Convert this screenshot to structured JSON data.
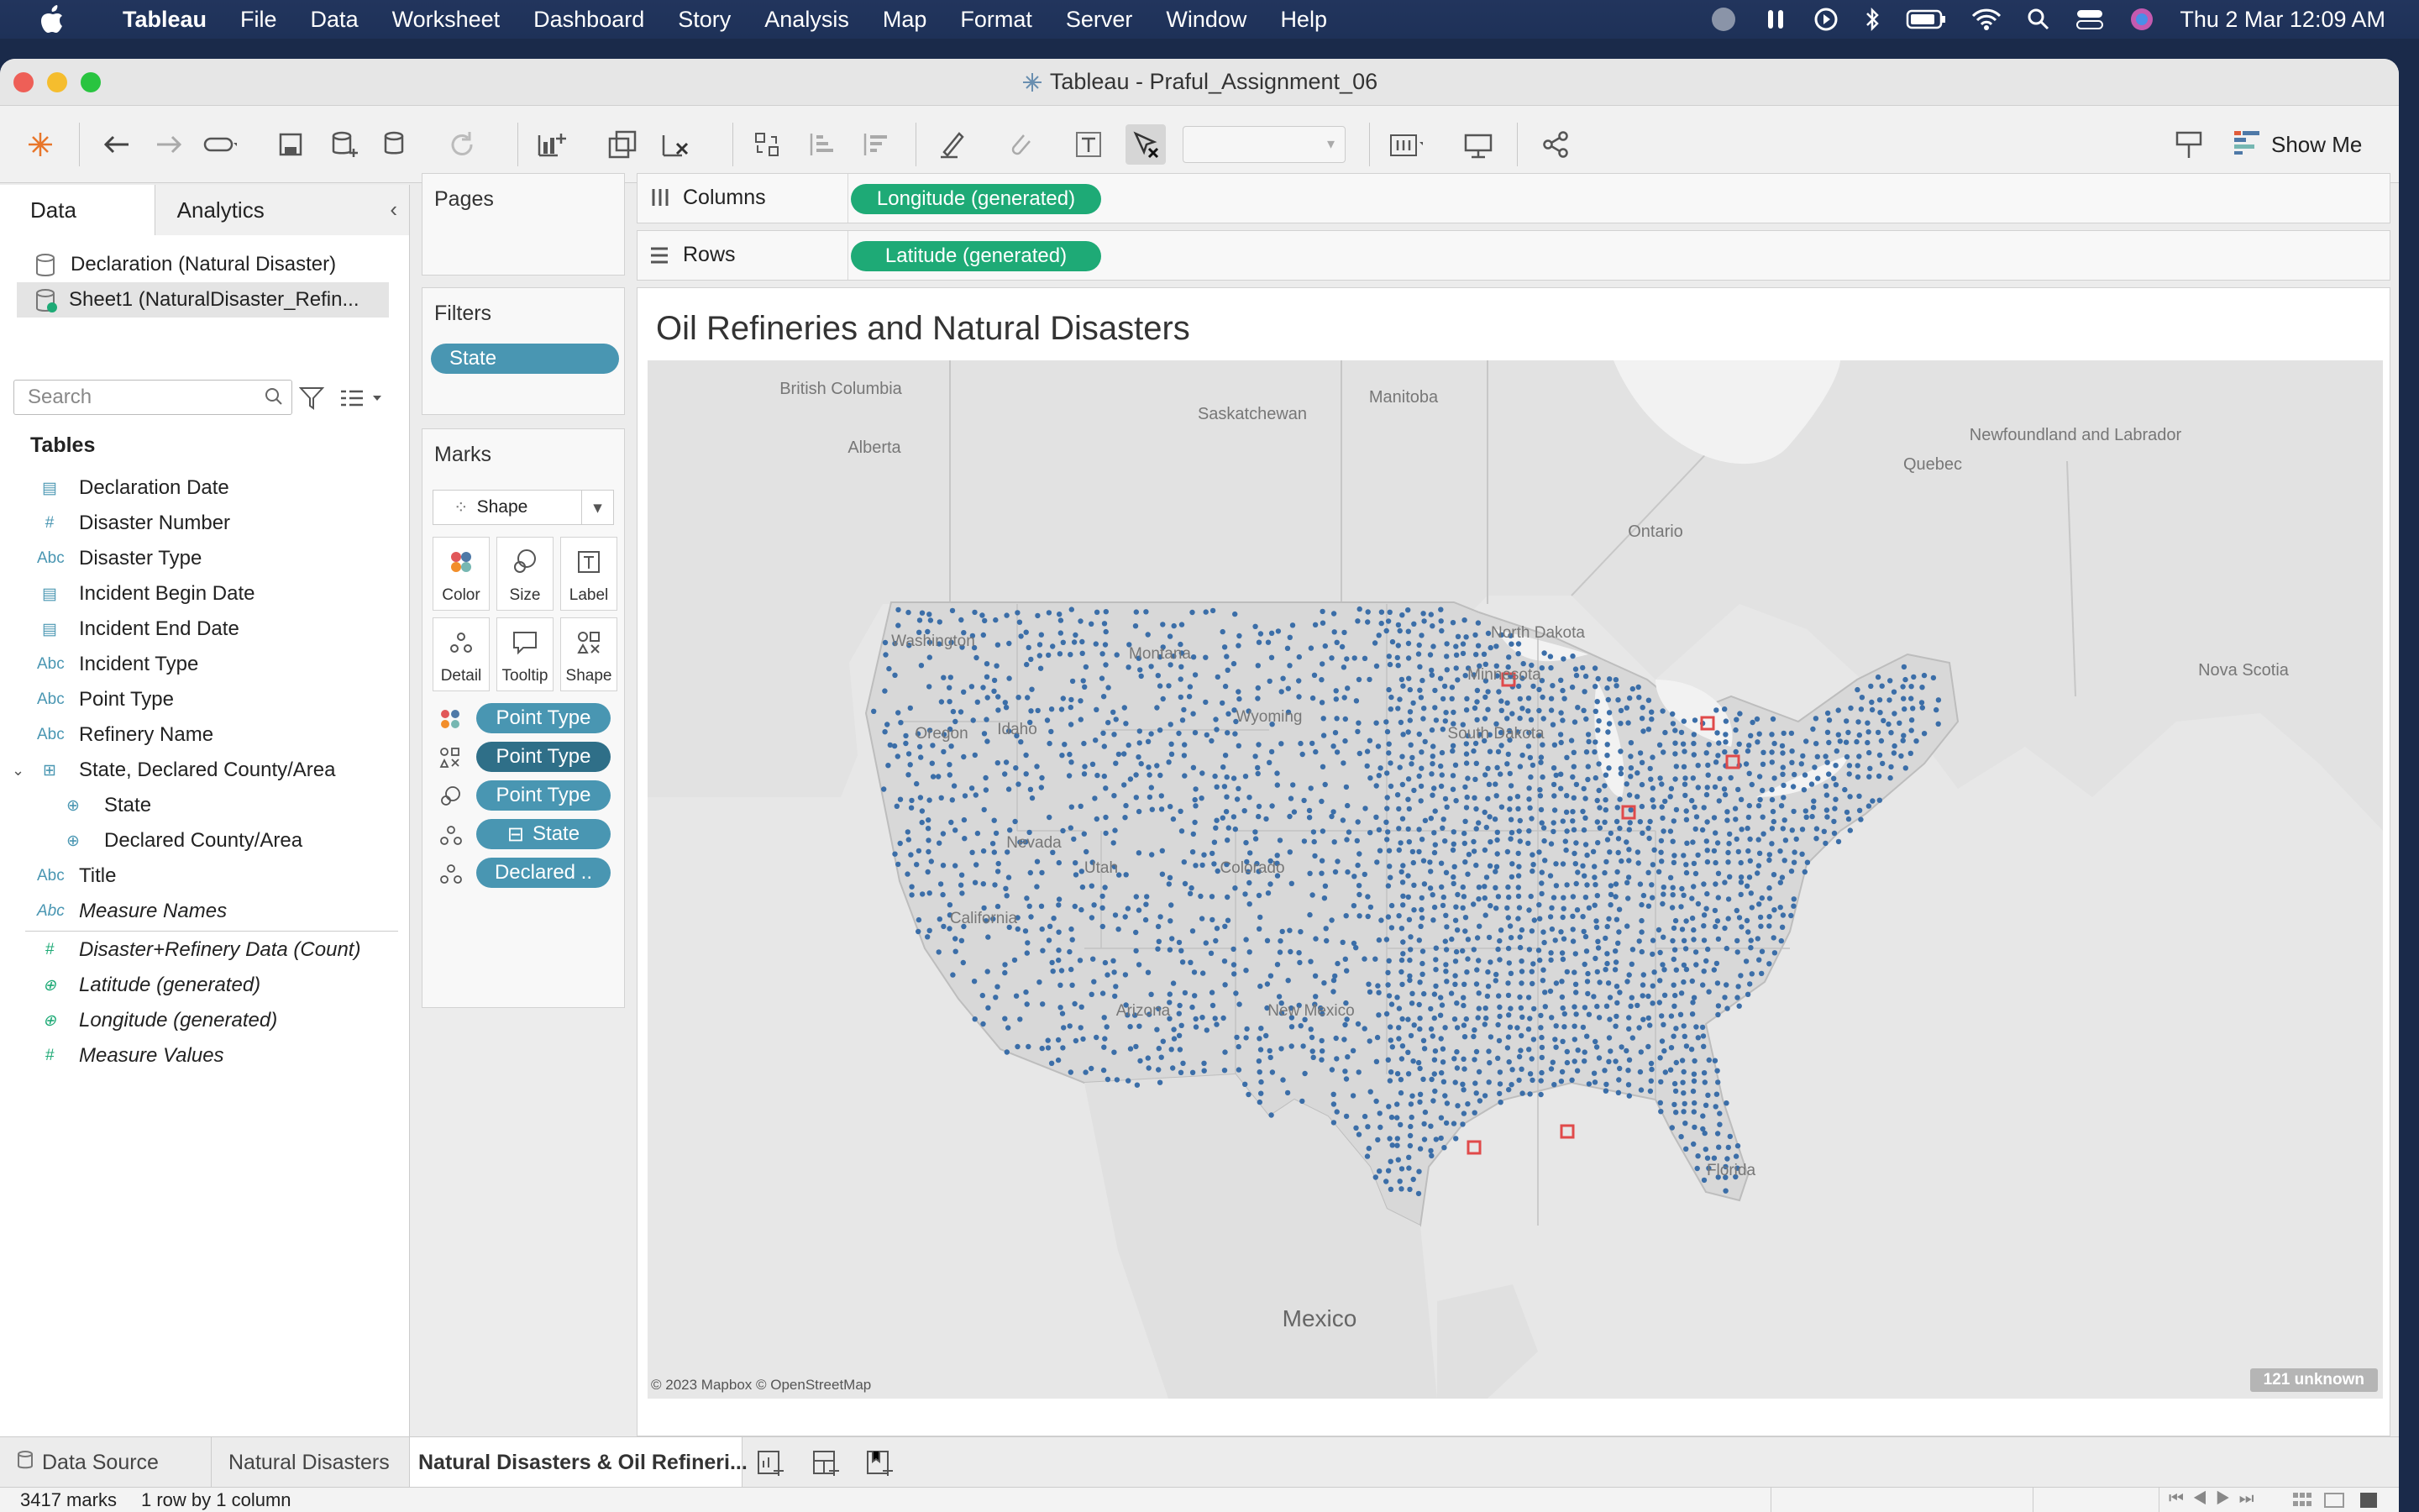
{
  "menubar": {
    "app": "Tableau",
    "items": [
      "File",
      "Data",
      "Worksheet",
      "Dashboard",
      "Story",
      "Analysis",
      "Map",
      "Format",
      "Server",
      "Window",
      "Help"
    ],
    "datetime": "Thu 2 Mar  12:09 AM"
  },
  "window": {
    "title": "Tableau - Praful_Assignment_06"
  },
  "toolbar": {
    "show_me": "Show Me"
  },
  "left_panel": {
    "tab_data": "Data",
    "tab_analytics": "Analytics",
    "datasources": [
      "Declaration (Natural Disaster)",
      "Sheet1 (NaturalDisaster_Refin..."
    ],
    "search_placeholder": "Search",
    "tables_header": "Tables",
    "fields": [
      {
        "type": "date",
        "label": "Declaration Date"
      },
      {
        "type": "#",
        "label": "Disaster Number"
      },
      {
        "type": "Abc",
        "label": "Disaster Type"
      },
      {
        "type": "date",
        "label": "Incident Begin Date"
      },
      {
        "type": "date",
        "label": "Incident End Date"
      },
      {
        "type": "Abc",
        "label": "Incident Type"
      },
      {
        "type": "Abc",
        "label": "Point Type"
      },
      {
        "type": "Abc",
        "label": "Refinery Name"
      },
      {
        "type": "hier",
        "label": "State, Declared County/Area"
      },
      {
        "type": "geo",
        "label": "State"
      },
      {
        "type": "geo",
        "label": "Declared County/Area"
      },
      {
        "type": "Abc",
        "label": "Title"
      },
      {
        "type": "Abc",
        "label": "Measure Names"
      },
      {
        "type": "#",
        "label": "Disaster+Refinery Data (Count)"
      },
      {
        "type": "geo",
        "label": "Latitude (generated)"
      },
      {
        "type": "geo",
        "label": "Longitude (generated)"
      },
      {
        "type": "#",
        "label": "Measure Values"
      }
    ]
  },
  "pages": {
    "title": "Pages"
  },
  "filters": {
    "title": "Filters",
    "pills": [
      "State"
    ]
  },
  "marks": {
    "title": "Marks",
    "mark_type": "Shape",
    "buttons": [
      "Color",
      "Size",
      "Label",
      "Detail",
      "Tooltip",
      "Shape"
    ],
    "pills": [
      "Point Type",
      "Point Type",
      "Point Type",
      "State",
      "Declared .."
    ]
  },
  "shelves": {
    "columns_label": "Columns",
    "columns_pill": "Longitude (generated)",
    "rows_label": "Rows",
    "rows_pill": "Latitude (generated)"
  },
  "view": {
    "title": "Oil Refineries and Natural Disasters",
    "attribution": "© 2023 Mapbox © OpenStreetMap",
    "unknown_badge": "121 unknown",
    "map_labels": [
      "British Columbia",
      "Alberta",
      "Saskatchewan",
      "Manitoba",
      "Ontario",
      "Quebec",
      "Newfoundland and Labrador",
      "Nova Scotia",
      "Mexico",
      "Washington",
      "Montana",
      "North Dakota",
      "Minnesota",
      "Oregon",
      "Idaho",
      "Wyoming",
      "South Dakota",
      "Nevada",
      "Utah",
      "Colorado",
      "California",
      "Arizona",
      "New Mexico",
      "Florida"
    ],
    "colors": {
      "point": "#3b6ea8",
      "refinery": "#e04a4a"
    }
  },
  "sheet_tabs": [
    "Data Source",
    "Natural Disasters",
    "Natural Disasters & Oil Refineri..."
  ],
  "status": {
    "marks": "3417 marks",
    "layout": "1 row by 1 column"
  }
}
